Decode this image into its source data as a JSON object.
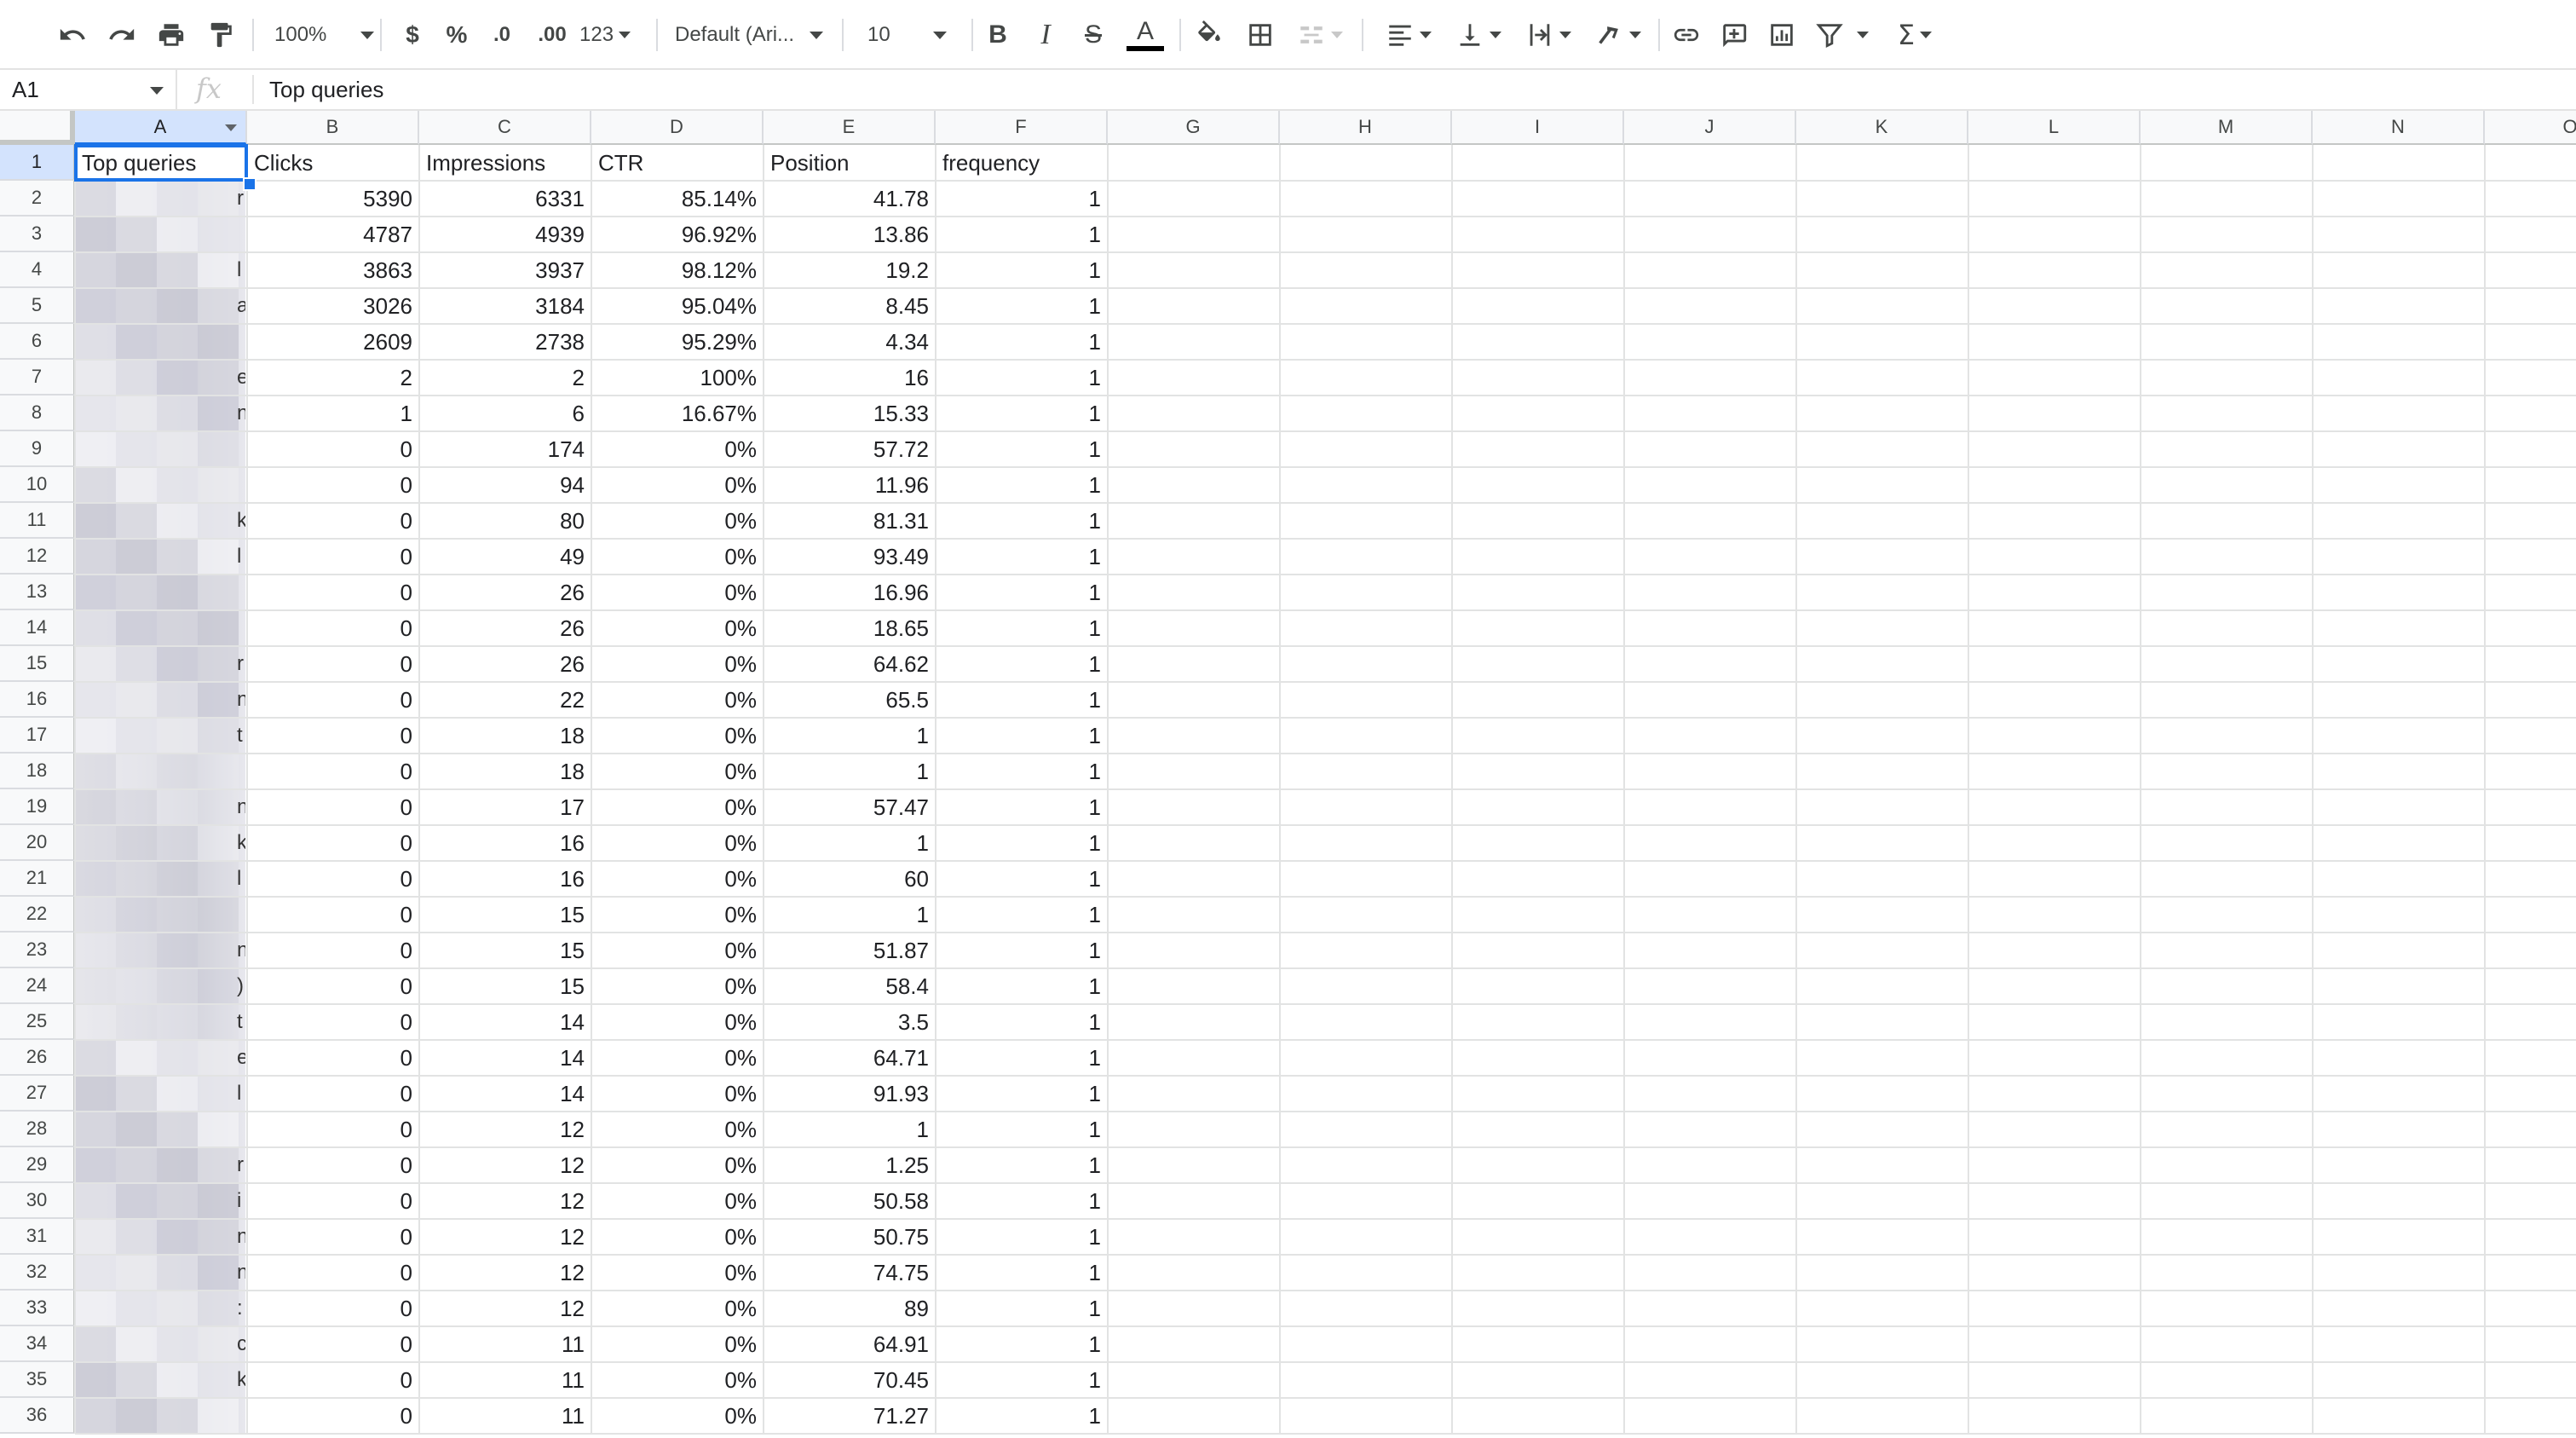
{
  "toolbar": {
    "zoom": "100%",
    "currency": "$",
    "percent": "%",
    "dec_decrease": ".0",
    "dec_increase": ".00",
    "more_formats": "123",
    "font": "Default (Ari...",
    "font_size": "10",
    "colors": {
      "text_color_bar": "#000000",
      "accent": "#1a73e8"
    }
  },
  "formula_bar": {
    "name_box": "A1",
    "fx_label": "fx",
    "value": "Top queries"
  },
  "sheet": {
    "columns": [
      "A",
      "B",
      "C",
      "D",
      "E",
      "F",
      "G",
      "H",
      "I",
      "J",
      "K",
      "L",
      "M",
      "N",
      "O"
    ],
    "headers": [
      "Top queries",
      "Clicks",
      "Impressions",
      "CTR",
      "Position",
      "frequency"
    ],
    "rows": [
      [
        "",
        "5390",
        "6331",
        "85.14%",
        "41.78",
        "1"
      ],
      [
        "",
        "4787",
        "4939",
        "96.92%",
        "13.86",
        "1"
      ],
      [
        "",
        "3863",
        "3937",
        "98.12%",
        "19.2",
        "1"
      ],
      [
        "",
        "3026",
        "3184",
        "95.04%",
        "8.45",
        "1"
      ],
      [
        "",
        "2609",
        "2738",
        "95.29%",
        "4.34",
        "1"
      ],
      [
        "",
        "2",
        "2",
        "100%",
        "16",
        "1"
      ],
      [
        "",
        "1",
        "6",
        "16.67%",
        "15.33",
        "1"
      ],
      [
        "",
        "0",
        "174",
        "0%",
        "57.72",
        "1"
      ],
      [
        "",
        "0",
        "94",
        "0%",
        "11.96",
        "1"
      ],
      [
        "",
        "0",
        "80",
        "0%",
        "81.31",
        "1"
      ],
      [
        "",
        "0",
        "49",
        "0%",
        "93.49",
        "1"
      ],
      [
        "",
        "0",
        "26",
        "0%",
        "16.96",
        "1"
      ],
      [
        "",
        "0",
        "26",
        "0%",
        "18.65",
        "1"
      ],
      [
        "",
        "0",
        "26",
        "0%",
        "64.62",
        "1"
      ],
      [
        "",
        "0",
        "22",
        "0%",
        "65.5",
        "1"
      ],
      [
        "",
        "0",
        "18",
        "0%",
        "1",
        "1"
      ],
      [
        "",
        "0",
        "18",
        "0%",
        "1",
        "1"
      ],
      [
        "",
        "0",
        "17",
        "0%",
        "57.47",
        "1"
      ],
      [
        "",
        "0",
        "16",
        "0%",
        "1",
        "1"
      ],
      [
        "",
        "0",
        "16",
        "0%",
        "60",
        "1"
      ],
      [
        "",
        "0",
        "15",
        "0%",
        "1",
        "1"
      ],
      [
        "",
        "0",
        "15",
        "0%",
        "51.87",
        "1"
      ],
      [
        "",
        "0",
        "15",
        "0%",
        "58.4",
        "1"
      ],
      [
        "",
        "0",
        "14",
        "0%",
        "3.5",
        "1"
      ],
      [
        "",
        "0",
        "14",
        "0%",
        "64.71",
        "1"
      ],
      [
        "",
        "0",
        "14",
        "0%",
        "91.93",
        "1"
      ],
      [
        "",
        "0",
        "12",
        "0%",
        "1",
        "1"
      ],
      [
        "",
        "0",
        "12",
        "0%",
        "1.25",
        "1"
      ],
      [
        "",
        "0",
        "12",
        "0%",
        "50.58",
        "1"
      ],
      [
        "",
        "0",
        "12",
        "0%",
        "50.75",
        "1"
      ],
      [
        "",
        "0",
        "12",
        "0%",
        "74.75",
        "1"
      ],
      [
        "",
        "0",
        "12",
        "0%",
        "89",
        "1"
      ],
      [
        "",
        "0",
        "11",
        "0%",
        "64.91",
        "1"
      ],
      [
        "",
        "0",
        "11",
        "0%",
        "70.45",
        "1"
      ],
      [
        "",
        "0",
        "11",
        "0%",
        "71.27",
        "1"
      ]
    ],
    "blurred_tails": [
      "r",
      "",
      "l",
      "a",
      "",
      "e",
      "n",
      "",
      "",
      "k",
      "l",
      "",
      "",
      "r",
      "n",
      "t",
      "",
      "n",
      "k",
      "l",
      "",
      "n",
      ")",
      "t",
      "e",
      "l",
      "",
      "r",
      "i",
      "n",
      "n",
      ":",
      "c",
      "k",
      ""
    ],
    "row_numbers": [
      "1",
      "2",
      "3",
      "4",
      "5",
      "6",
      "7",
      "8",
      "9",
      "10",
      "11",
      "12",
      "13",
      "14",
      "15",
      "16",
      "17",
      "18",
      "19",
      "20",
      "21",
      "22",
      "23",
      "24",
      "25",
      "26",
      "27",
      "28",
      "29",
      "30",
      "31",
      "32",
      "33",
      "34",
      "35",
      "36"
    ],
    "selected_cell": "A1"
  }
}
